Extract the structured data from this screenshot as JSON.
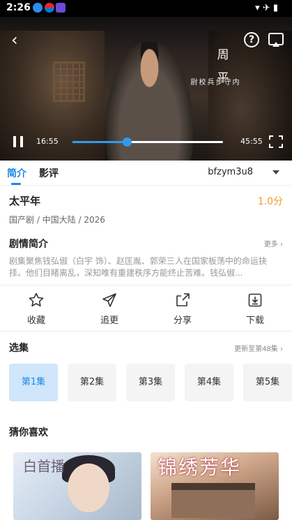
{
  "status": {
    "time": "2:26"
  },
  "player": {
    "current_time": "16:55",
    "total_time": "45:55",
    "progress": 0.36,
    "subtitle_line1": "周",
    "subtitle_line2": "平",
    "subtitle_small": "内守步兵校尉"
  },
  "tabs": [
    {
      "label": "简介"
    },
    {
      "label": "影评"
    }
  ],
  "source": {
    "label": "bfzym3u8"
  },
  "show": {
    "title": "太平年",
    "score": "1.0分",
    "meta": "国产剧 / 中国大陆 / 2026"
  },
  "synopsis": {
    "heading": "剧情简介",
    "more": "更多",
    "text": "剧集聚焦钱弘俶（白宇 饰）、赵匡胤、郭荣三人在国家板荡中的命运抉择。他们目睹离乱，深知唯有重建秩序方能终止苦难。钱弘俶..."
  },
  "actions": [
    {
      "label": "收藏",
      "icon": "star-icon"
    },
    {
      "label": "追更",
      "icon": "send-icon"
    },
    {
      "label": "分享",
      "icon": "share-icon"
    },
    {
      "label": "下载",
      "icon": "download-icon"
    }
  ],
  "episodes": {
    "heading": "选集",
    "update_text": "更新至第48集",
    "items": [
      "第1集",
      "第2集",
      "第3集",
      "第4集",
      "第5集"
    ],
    "selected": 0
  },
  "recommend": {
    "heading": "猜你喜欢",
    "poster1_logo": "白首播",
    "poster2_logo": "锦绣芳华"
  },
  "colors": {
    "accent": "#1e88e5",
    "score": "#f39c2b",
    "selected_episode_bg": "#cfe6fb"
  }
}
